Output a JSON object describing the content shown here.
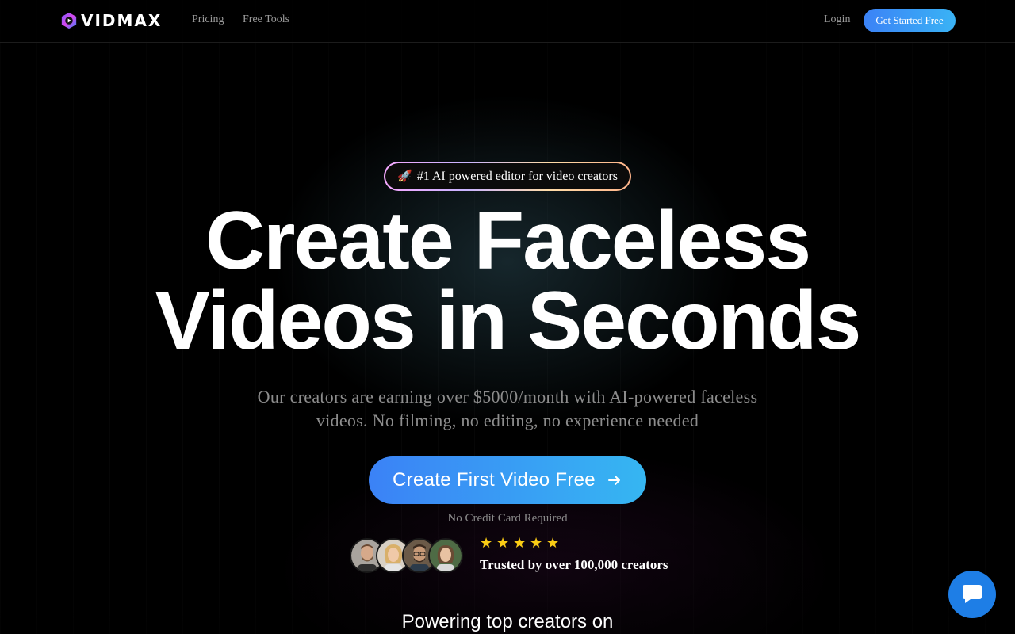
{
  "header": {
    "brand": "VIDMAX",
    "nav": [
      "Pricing",
      "Free Tools"
    ],
    "login_label": "Login",
    "get_started_label": "Get Started Free"
  },
  "hero": {
    "badge_icon": "rocket-icon",
    "badge_text": "#1 AI powered editor for video creators",
    "headline_line1": "Create Faceless",
    "headline_line2": "Videos in Seconds",
    "subheadline": "Our creators are earning over $5000/month with AI-powered faceless videos. No filming, no editing, no experience needed",
    "cta_label": "Create First Video Free",
    "cta_icon": "arrow-right-icon",
    "cta_note": "No Credit Card Required"
  },
  "social_proof": {
    "rating_stars": 5,
    "trusted_text": "Trusted by over 100,000 creators",
    "avatar_count": 4
  },
  "section": {
    "powering_title": "Powering top creators on"
  },
  "chat": {
    "icon": "chat-bubble-icon"
  },
  "colors": {
    "accent_start": "#3b82f6",
    "accent_end": "#36b6f2",
    "star": "#facc15",
    "chat": "#1e7ee6",
    "background": "#000000"
  }
}
